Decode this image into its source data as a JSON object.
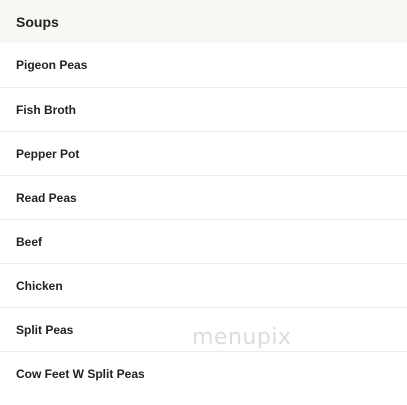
{
  "section": {
    "title": "Soups"
  },
  "items": [
    {
      "label": "Pigeon Peas"
    },
    {
      "label": "Fish Broth"
    },
    {
      "label": "Pepper Pot"
    },
    {
      "label": "Read Peas"
    },
    {
      "label": "Beef"
    },
    {
      "label": "Chicken"
    },
    {
      "label": "Split Peas"
    },
    {
      "label": "Cow Feet W Split Peas"
    }
  ],
  "watermark": {
    "text": "menupix"
  }
}
